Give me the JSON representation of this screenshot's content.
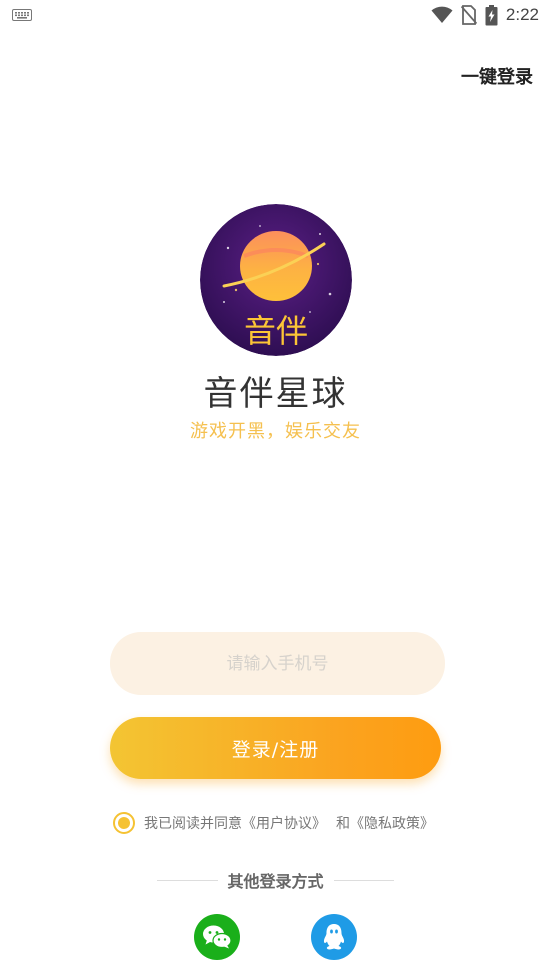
{
  "status_bar": {
    "time": "2:22",
    "icons": [
      "keyboard-icon",
      "wifi-icon",
      "no-sim-icon",
      "battery-charging-icon"
    ]
  },
  "header": {
    "quick_login_label": "一键登录"
  },
  "brand": {
    "logo_text": "音伴",
    "app_name": "音伴星球",
    "slogan": "游戏开黑，娱乐交友",
    "accent_color": "#f5c04f"
  },
  "form": {
    "phone_placeholder": "请输入手机号",
    "phone_value": "",
    "login_button_label": "登录/注册"
  },
  "agreement": {
    "checked": true,
    "prefix": "我已阅读并同意",
    "user_agreement": "《用户协议》",
    "conjunction": "和",
    "privacy_policy": "《隐私政策》"
  },
  "other_login": {
    "label": "其他登录方式",
    "providers": [
      {
        "name": "WeChat",
        "icon": "wechat-icon",
        "color": "#1aaf1a"
      },
      {
        "name": "QQ",
        "icon": "qq-icon",
        "color": "#1f9be6"
      }
    ]
  }
}
